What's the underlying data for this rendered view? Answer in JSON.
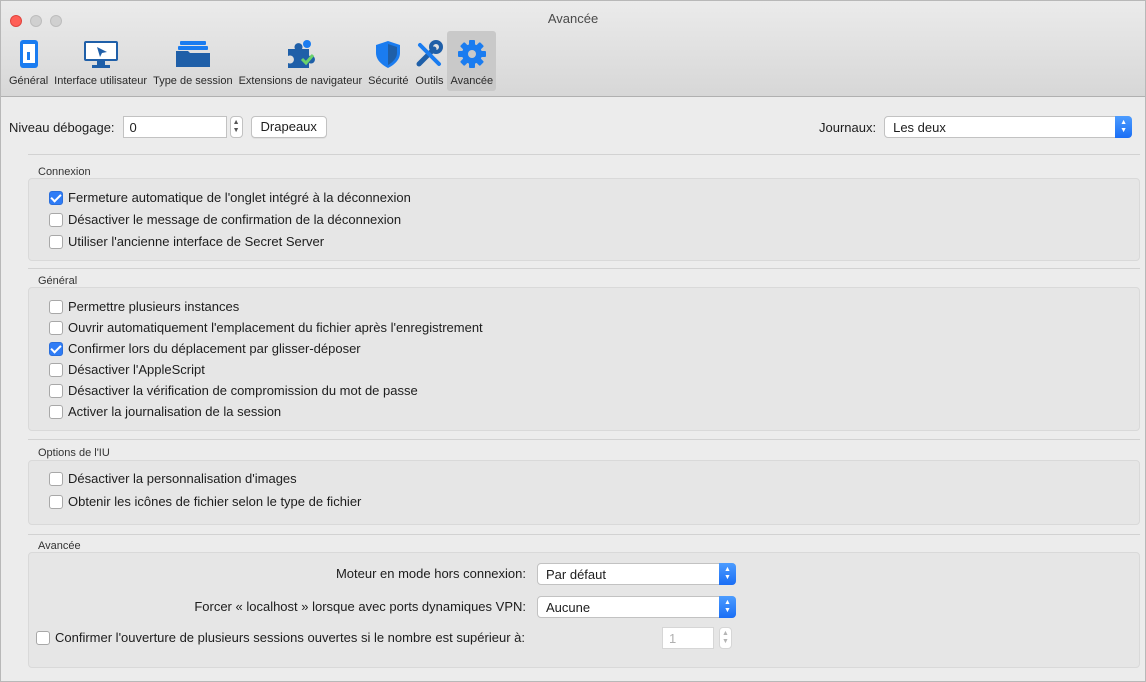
{
  "window": {
    "title": "Avancée"
  },
  "toolbar": {
    "tabs": [
      {
        "label": "Général",
        "icon": "phone-icon"
      },
      {
        "label": "Interface utilisateur",
        "icon": "monitor-cursor-icon"
      },
      {
        "label": "Type de session",
        "icon": "folder-stack-icon"
      },
      {
        "label": "Extensions de navigateur",
        "icon": "puzzle-icon"
      },
      {
        "label": "Sécurité",
        "icon": "shield-icon"
      },
      {
        "label": "Outils",
        "icon": "tools-icon"
      },
      {
        "label": "Avancée",
        "icon": "gear-icon",
        "active": true
      }
    ]
  },
  "debug": {
    "label": "Niveau débogage:",
    "value": "0",
    "flags_button": "Drapeaux"
  },
  "logs": {
    "label": "Journaux:",
    "value": "Les deux"
  },
  "connexion": {
    "title": "Connexion",
    "items": [
      {
        "label": "Fermeture automatique de l'onglet intégré à la déconnexion",
        "checked": true
      },
      {
        "label": "Désactiver le message de confirmation de la déconnexion",
        "checked": false
      },
      {
        "label": "Utiliser l'ancienne interface de Secret Server",
        "checked": false
      }
    ]
  },
  "general": {
    "title": "Général",
    "items": [
      {
        "label": "Permettre plusieurs instances",
        "checked": false
      },
      {
        "label": "Ouvrir automatiquement l'emplacement du fichier après l'enregistrement",
        "checked": false
      },
      {
        "label": "Confirmer lors du déplacement par glisser-déposer",
        "checked": true
      },
      {
        "label": "Désactiver l'AppleScript",
        "checked": false
      },
      {
        "label": "Désactiver la vérification de compromission du mot de passe",
        "checked": false
      },
      {
        "label": "Activer la journalisation de la session",
        "checked": false
      }
    ]
  },
  "ui_options": {
    "title": "Options de l'IU",
    "items": [
      {
        "label": "Désactiver la personnalisation d'images",
        "checked": false
      },
      {
        "label": "Obtenir les icônes de fichier selon le type de fichier",
        "checked": false
      }
    ]
  },
  "advanced": {
    "title": "Avancée",
    "offline_engine_label": "Moteur en mode hors connexion:",
    "offline_engine_value": "Par défaut",
    "force_localhost_label": "Forcer « localhost » lorsque avec ports dynamiques VPN:",
    "force_localhost_value": "Aucune",
    "confirm_sessions_label": "Confirmer l'ouverture de plusieurs sessions ouvertes si le nombre est supérieur à:",
    "confirm_sessions_checked": false,
    "confirm_sessions_value": "1"
  },
  "colors": {
    "accent": "#2f7cf6",
    "icon_blue": "#1a7cf0",
    "icon_dark": "#1f5fa8"
  }
}
